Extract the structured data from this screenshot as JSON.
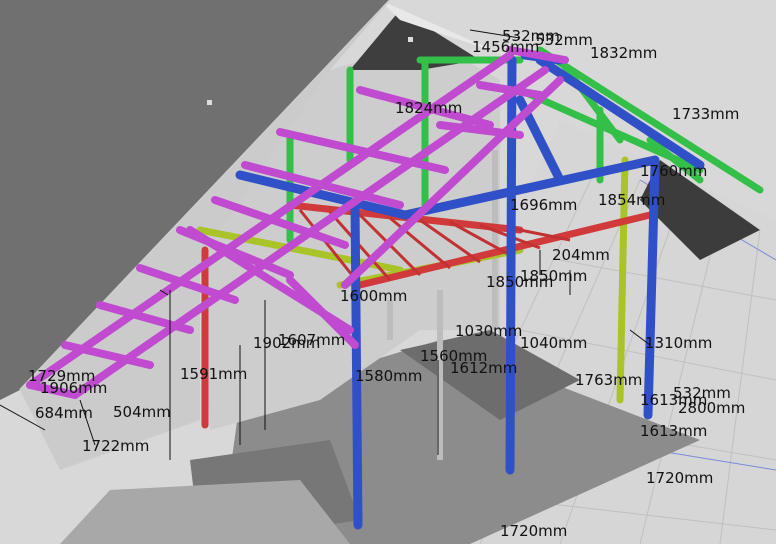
{
  "colors": {
    "background": "#d8d8d8",
    "roof": "#6e6e6e",
    "wall": "#cfcfcf",
    "floor": "#8a8a8a",
    "floor_tiles": "#c9c9c9",
    "grid": "#9aa6c8",
    "rafter_purple": "#c04ad0",
    "post_blue": "#3050c8",
    "green": "#34c048",
    "olive": "#a8c428",
    "red": "#d03a3a",
    "dim_text": "#111111"
  },
  "dimensions": [
    {
      "label": "532mm"
    },
    {
      "label": "1456mm"
    },
    {
      "label": "532mm"
    },
    {
      "label": "1832mm"
    },
    {
      "label": "1824mm"
    },
    {
      "label": "1733mm"
    },
    {
      "label": "1760mm"
    },
    {
      "label": "1696mm"
    },
    {
      "label": "1854mm"
    },
    {
      "label": "204mm"
    },
    {
      "label": "1850mm"
    },
    {
      "label": "1850mm"
    },
    {
      "label": "1600mm"
    },
    {
      "label": "1607mm"
    },
    {
      "label": "1902mm"
    },
    {
      "label": "1030mm"
    },
    {
      "label": "1040mm"
    },
    {
      "label": "1310mm"
    },
    {
      "label": "1560mm"
    },
    {
      "label": "1612mm"
    },
    {
      "label": "1591mm"
    },
    {
      "label": "1580mm"
    },
    {
      "label": "1763mm"
    },
    {
      "label": "532mm"
    },
    {
      "label": "1613mm"
    },
    {
      "label": "2800mm"
    },
    {
      "label": "1613mm"
    },
    {
      "label": "1720mm"
    },
    {
      "label": "1720mm"
    },
    {
      "label": "1722mm"
    },
    {
      "label": "684mm"
    },
    {
      "label": "504mm"
    },
    {
      "label": "1729mm"
    },
    {
      "label": "1906mm"
    }
  ]
}
